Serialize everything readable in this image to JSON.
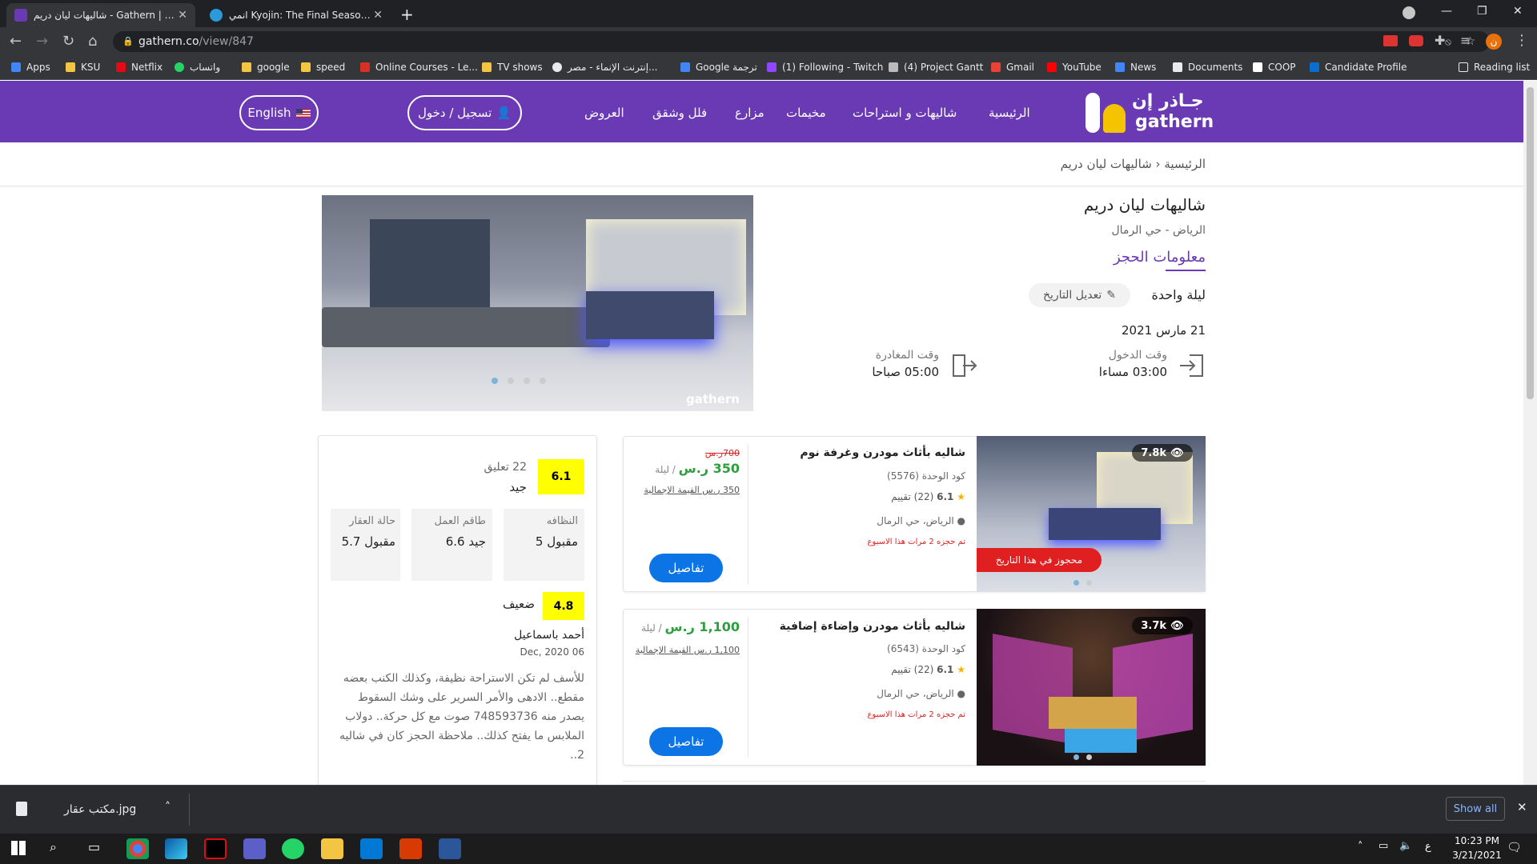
{
  "browser": {
    "tabs": [
      {
        "title": "شاليهات ليان دريم - Gathern | جاذر"
      },
      {
        "title": "انمي Kyojin: The Final Season no"
      }
    ],
    "url_host": "gathern.co",
    "url_path": "/view/847",
    "bookmarks": [
      "Apps",
      "KSU",
      "Netflix",
      "واتساب",
      "google",
      "speed",
      "Online Courses - Le...",
      "TV shows",
      "إنترنت الإنماء - مصر...",
      "Google ترجمة",
      "(1) Following - Twitch",
      "(4) Project Gantt",
      "Gmail",
      "YouTube",
      "News",
      "Documents",
      "COOP",
      "Candidate Profile"
    ],
    "reading_list": "Reading list"
  },
  "site": {
    "logo_ar": "جـاذر إن",
    "logo_en": "gathern",
    "nav": [
      "الرئيسية",
      "شاليهات و استراحات",
      "مخيمات",
      "مزارع",
      "فلل وشقق",
      "العروض"
    ],
    "login": "تسجيل / دخول",
    "lang": "English",
    "breadcrumb": {
      "home": "الرئيسية",
      "current": "شاليهات ليان دريم"
    }
  },
  "property": {
    "title": "شاليهات ليان دريم",
    "location": "الرياض - حي الرمال",
    "booking_info": "معلومات الحجز",
    "nights": "ليلة واحدة",
    "edit_date": "تعديل التاريخ",
    "date": "21 مارس 2021",
    "checkin_label": "وقت الدخول",
    "checkin_time": "03:00 مساءا",
    "checkout_label": "وقت المغادرة",
    "checkout_time": "05:00 صباحا",
    "image_watermark": "gathern"
  },
  "units": [
    {
      "title": "شاليه بأثاث مودرن وغرفة نوم",
      "code": "كود الوحدة (5576)",
      "rating": "6.1",
      "reviews": "(22) تقييم",
      "location": "الرياض، حي الرمال",
      "booked_week": "تم حجزه 2 مرات هذا الاسبوع",
      "old_price": "700ر.س",
      "price": "350 ر.س",
      "per_night": "ليلة",
      "total": "350 ر.س القيمة الإجمالية",
      "details": "تفاصيل",
      "views": "7.8k",
      "booked_badge": "محجوز في هذا التاريخ"
    },
    {
      "title": "شاليه بأثاث مودرن وإضاءة إضافية",
      "code": "كود الوحدة (6543)",
      "rating": "6.1",
      "reviews": "(22) تقييم",
      "location": "الرياض، حي الرمال",
      "booked_week": "تم حجزه 2 مرات هذا الاسبوع",
      "price": "1,100 ر.س",
      "per_night": "ليلة",
      "total": "1,100 ر.س القيمة الإجمالية",
      "details": "تفاصيل",
      "views": "3.7k"
    }
  ],
  "reviews": {
    "score": "6.1",
    "comments": "22 تعليق",
    "label": "جيد",
    "categories": [
      {
        "name": "النظافه",
        "value": "مقبول 5"
      },
      {
        "name": "طاقم العمل",
        "value": "جيد 6.6"
      },
      {
        "name": "حالة العقار",
        "value": "مقبول 5.7"
      }
    ],
    "review": {
      "score": "4.8",
      "label": "ضعيف",
      "author": "أحمد باسماعيل",
      "date": "06 Dec, 2020",
      "text": "للأسف لم تكن الاستراحة نظيفة، وكذلك الكنب بعضه مقطع.. الادهى والأمر السرير على وشك السقوط يصدر منه 748593736 صوت مع كل حركة.. دولاب الملابس ما يفتح كذلك.. ملاحظة الحجز كان في شاليه 2.."
    }
  },
  "downloads": {
    "file": "مكتب عقار.jpg",
    "show_all": "Show all"
  },
  "taskbar": {
    "time": "10:23 PM",
    "date": "3/21/2021",
    "lang": "ع"
  },
  "colors": {
    "brand": "#6a3ab4",
    "accent_yellow": "#f5c400",
    "price_green": "#2e9e3e",
    "button_blue": "#0d74e6",
    "booked_red": "#e02020"
  }
}
